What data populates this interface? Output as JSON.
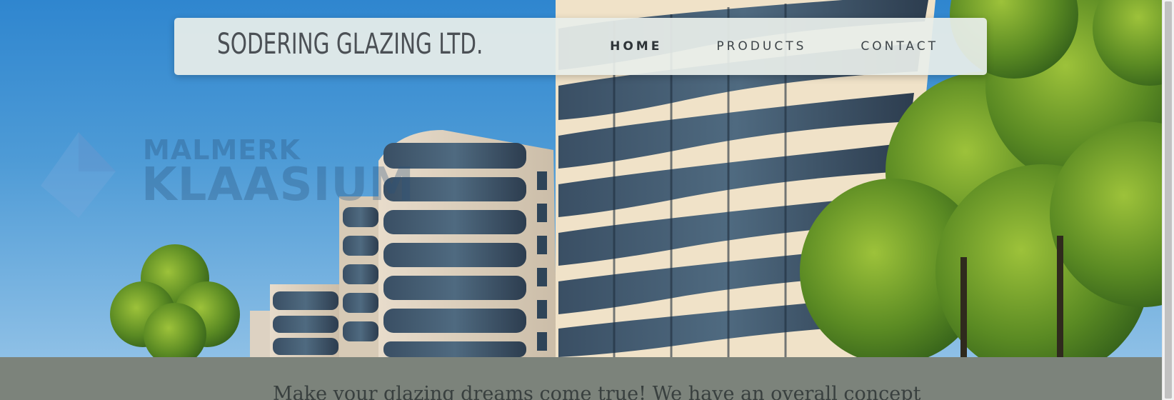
{
  "brand": {
    "name": "SODERING GLAZING LTD."
  },
  "nav": {
    "items": [
      {
        "label": "HOME",
        "active": true
      },
      {
        "label": "PRODUCTS",
        "active": false
      },
      {
        "label": "CONTACT",
        "active": false
      }
    ]
  },
  "hero": {
    "watermark_line1": "MALMERK",
    "watermark_line2": "KLAASIUM"
  },
  "intro": {
    "tagline": "Make your glazing dreams come true! We have an overall concept"
  },
  "colors": {
    "sky": "#2f86cf",
    "navbar_bg": "#e8eee9",
    "band": "#7c837b",
    "text_dark": "#3d4448"
  }
}
